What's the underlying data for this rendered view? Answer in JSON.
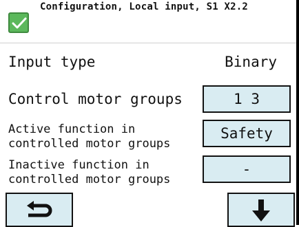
{
  "header": {
    "title": "Configuration, Local input, S1 X2.2",
    "status_icon": "check-icon",
    "status_color": "#5cb85c"
  },
  "rows": {
    "input_type": {
      "label": "Input type",
      "value": "Binary"
    },
    "control_motor_groups": {
      "label": "Control motor groups",
      "value": "1 3"
    },
    "active_function": {
      "label": "Active function in controlled motor groups",
      "value": "Safety"
    },
    "inactive_function": {
      "label": "Inactive function in controlled motor groups",
      "value": "-"
    }
  },
  "nav": {
    "back_icon": "return-arrow-icon",
    "down_icon": "down-arrow-icon"
  },
  "colors": {
    "button_bg": "#d9ecf2",
    "border": "#111111"
  }
}
